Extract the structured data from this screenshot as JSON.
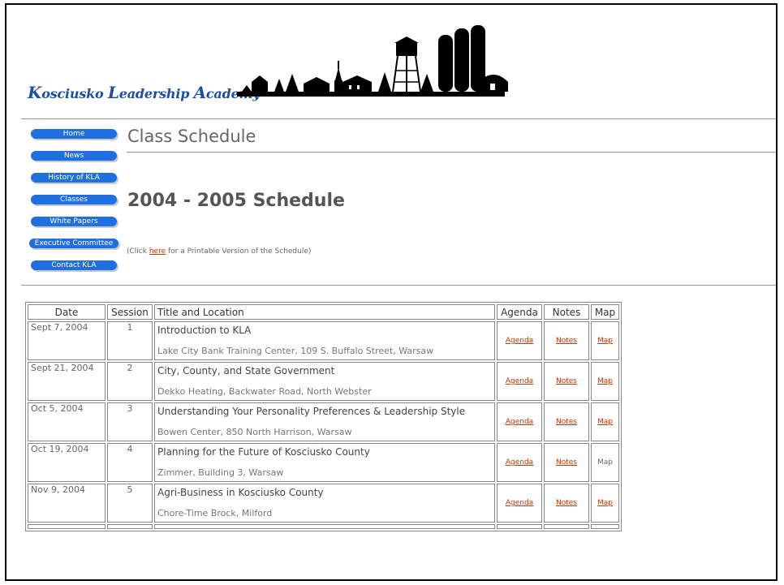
{
  "header": {
    "logo_text": {
      "k": "K",
      "osciusko": "osciusko ",
      "l": "L",
      "eadership": "eadership ",
      "a": "A",
      "cademy": "cademy"
    }
  },
  "nav": {
    "items": [
      {
        "label": "Home"
      },
      {
        "label": "News"
      },
      {
        "label": "History of KLA"
      },
      {
        "label": "Classes"
      },
      {
        "label": "White Papers"
      },
      {
        "label": "Executive Committee"
      },
      {
        "label": "Contact KLA"
      }
    ]
  },
  "main": {
    "page_title": "Class Schedule",
    "schedule_heading": "2004 - 2005 Schedule",
    "printable_prefix": "(Click ",
    "printable_link": "here",
    "printable_suffix": " for a Printable Version of the Schedule)"
  },
  "table": {
    "headers": {
      "date": "Date",
      "session": "Session",
      "title": "Title and Location",
      "agenda": "Agenda",
      "notes": "Notes",
      "map": "Map"
    },
    "rows": [
      {
        "date": "Sept 7, 2004",
        "session": "1",
        "title": "Introduction to KLA",
        "location": "Lake City Bank Training Center, 109 S. Buffalo Street, Warsaw",
        "agenda": "Agenda",
        "notes": "Notes",
        "map": "Map",
        "map_linked": true
      },
      {
        "date": "Sept 21, 2004",
        "session": "2",
        "title": "City, County, and State Government",
        "location": "Dekko Heating, Backwater Road, North Webster",
        "agenda": "Agenda",
        "notes": "Notes",
        "map": "Map",
        "map_linked": true
      },
      {
        "date": "Oct 5, 2004",
        "session": "3",
        "title": "Understanding Your Personality Preferences & Leadership Style",
        "location": "Bowen Center, 850 North Harrison, Warsaw",
        "agenda": "Agenda",
        "notes": "Notes",
        "map": "Map",
        "map_linked": true
      },
      {
        "date": "Oct 19, 2004",
        "session": "4",
        "title": "Planning for the Future of Kosciusko County",
        "location": "Zimmer, Building 3, Warsaw",
        "agenda": "Agenda",
        "notes": "Notes",
        "map": "Map",
        "map_linked": false
      },
      {
        "date": "Nov 9, 2004",
        "session": "5",
        "title": "Agri-Business in Kosciusko County",
        "location": "Chore-Time Brock, Milford",
        "agenda": "Agenda",
        "notes": "Notes",
        "map": "Map",
        "map_linked": true
      }
    ]
  },
  "colors": {
    "nav_button": "#1f6fe0",
    "link": "#cc3300",
    "logo_text": "#1a4fa3"
  }
}
